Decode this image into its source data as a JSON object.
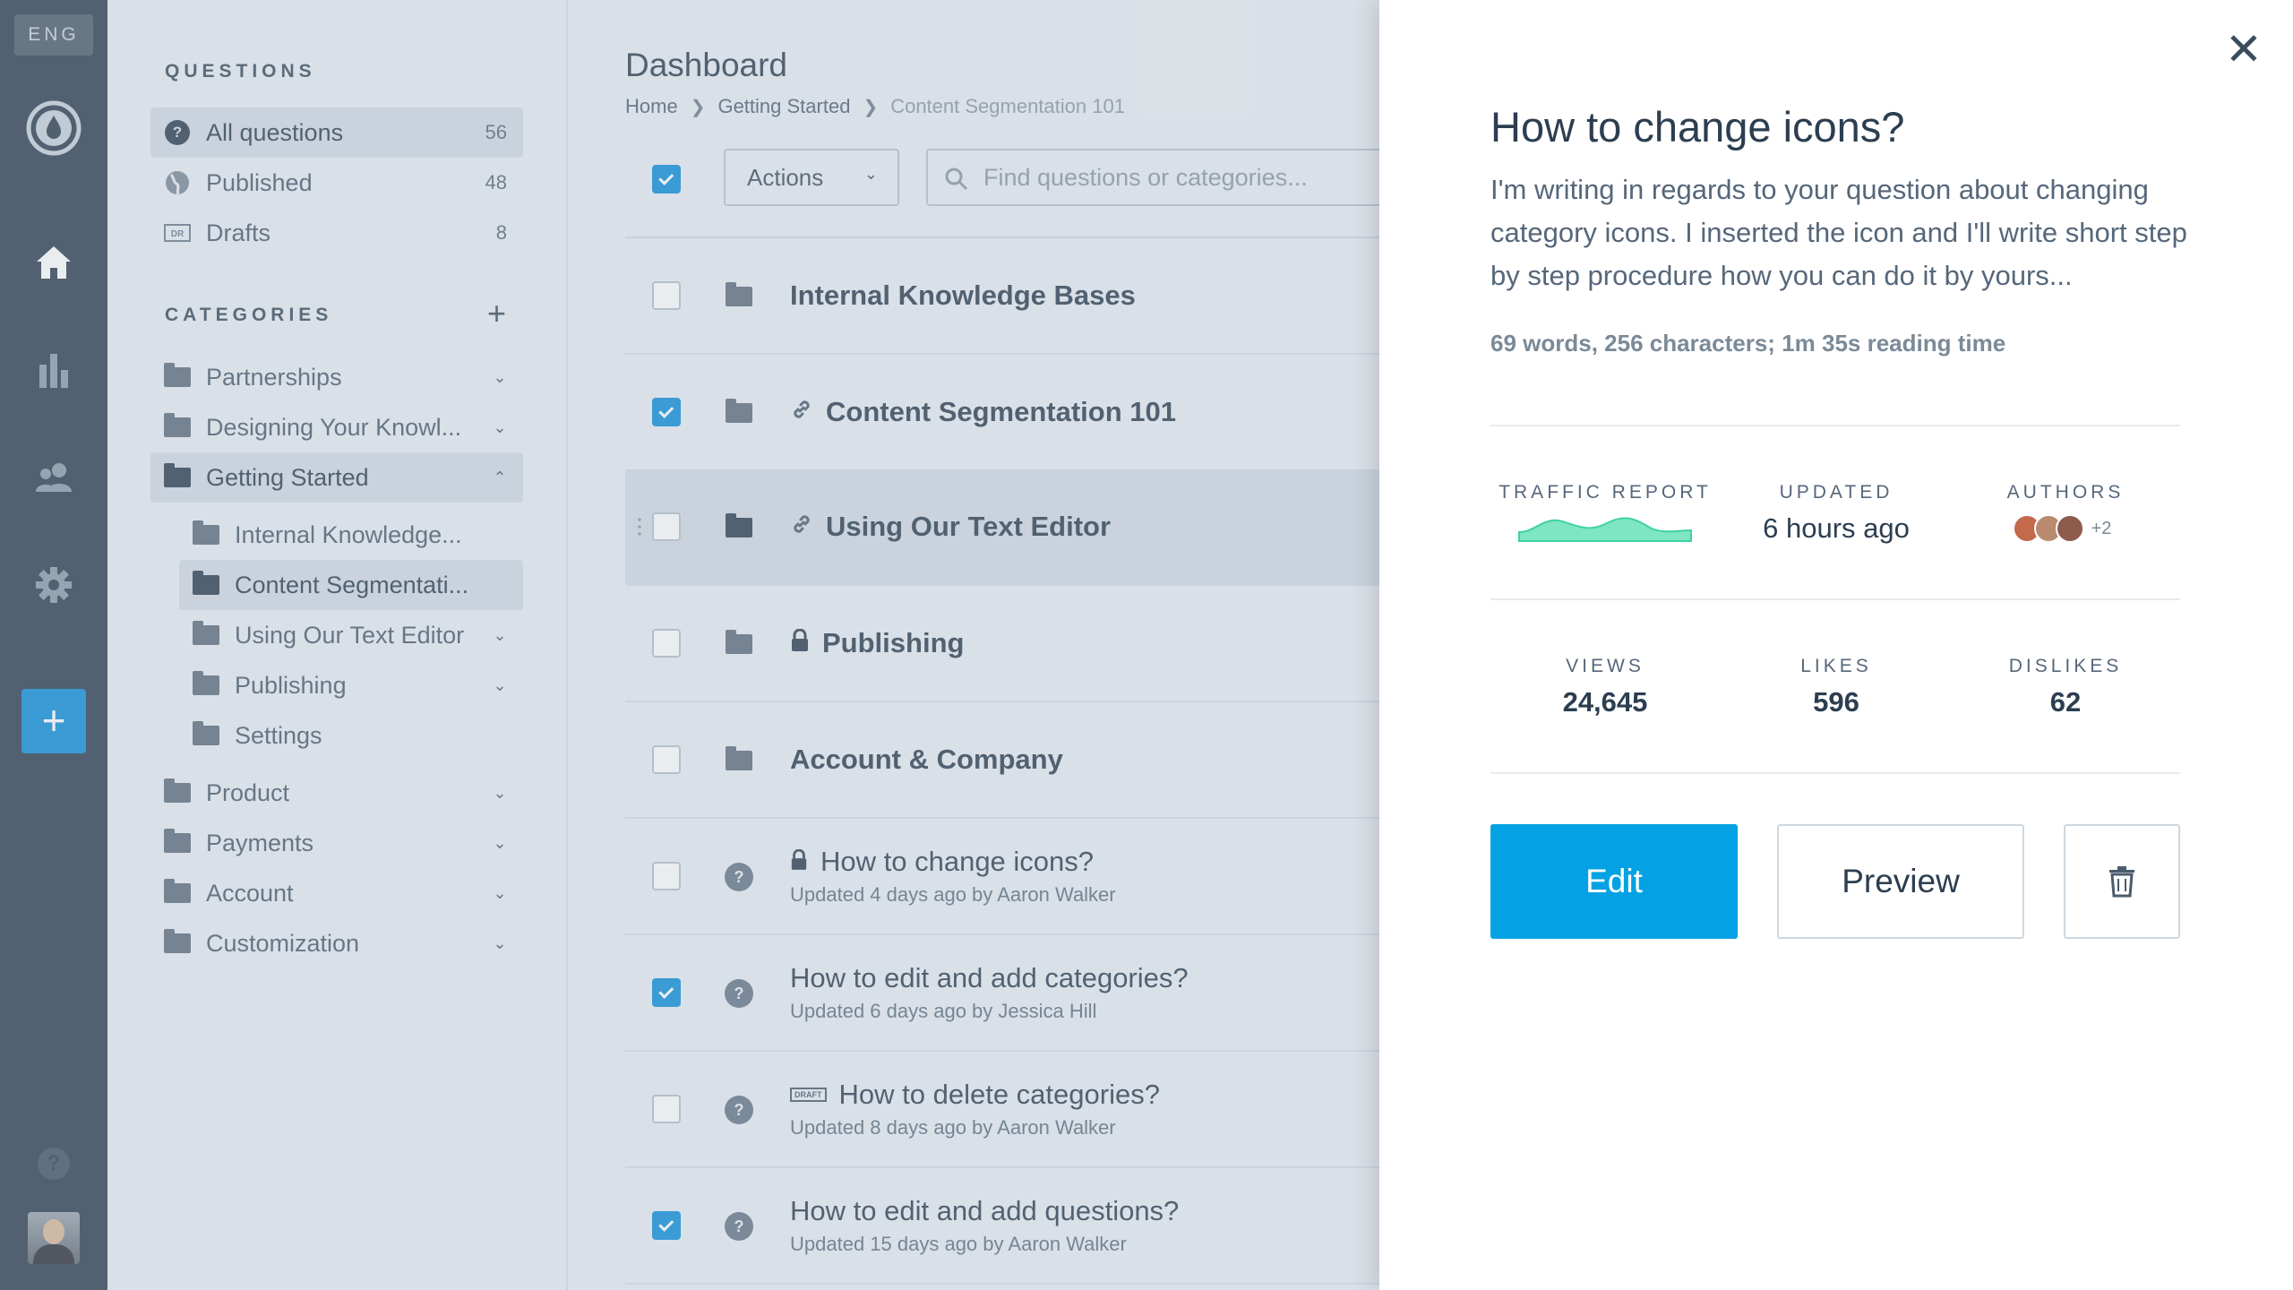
{
  "rail": {
    "lang": "ENG",
    "items": [
      {
        "icon": "logo-drop-icon"
      },
      {
        "icon": "home-icon"
      },
      {
        "icon": "bar-chart-icon"
      },
      {
        "icon": "users-icon"
      },
      {
        "icon": "gear-icon"
      }
    ],
    "add_label": "+",
    "help_label": "?"
  },
  "sidebar": {
    "questions_heading": "QUESTIONS",
    "question_filters": [
      {
        "label": "All questions",
        "count": "56"
      },
      {
        "label": "Published",
        "count": "48"
      },
      {
        "label": "Drafts",
        "count": "8"
      }
    ],
    "categories_heading": "CATEGORIES",
    "categories": [
      {
        "label": "Partnerships"
      },
      {
        "label": "Designing Your Knowl..."
      },
      {
        "label": "Getting Started"
      },
      {
        "label": "Internal Knowledge..."
      },
      {
        "label": "Content Segmentati..."
      },
      {
        "label": "Using Our Text Editor"
      },
      {
        "label": "Publishing"
      },
      {
        "label": "Settings"
      },
      {
        "label": "Product"
      },
      {
        "label": "Payments"
      },
      {
        "label": "Account"
      },
      {
        "label": "Customization"
      }
    ]
  },
  "main": {
    "title": "Dashboard",
    "breadcrumb": [
      "Home",
      "Getting Started",
      "Content Segmentation 101"
    ],
    "actions_label": "Actions",
    "search_placeholder": "Find questions or categories...",
    "rows": [
      {
        "title": "Internal Knowledge Bases"
      },
      {
        "title": "Content Segmentation 101"
      },
      {
        "title": "Using Our Text Editor"
      },
      {
        "title": "Publishing"
      },
      {
        "title": "Account & Company"
      },
      {
        "title": "How to change icons?",
        "sub": "Updated 4 days ago by Aaron Walker"
      },
      {
        "title": "How to edit and add categories?",
        "sub": "Updated 6 days ago by Jessica Hill"
      },
      {
        "title": "How to delete categories?",
        "sub": "Updated 8 days ago by Aaron Walker"
      },
      {
        "title": "How to edit and add questions?",
        "sub": "Updated 15 days ago by Aaron Walker"
      }
    ]
  },
  "panel": {
    "title": "How to change icons?",
    "body": "I'm writing in regards to your question about changing category icons. I inserted the icon and I'll write short step by step procedure how you can do it by yours...",
    "meta": "69 words, 256 characters; 1m 35s reading time",
    "traffic_label": "TRAFFIC REPORT",
    "updated_label": "UPDATED",
    "updated_value": "6 hours ago",
    "authors_label": "AUTHORS",
    "authors_more": "+2",
    "views_label": "VIEWS",
    "views_value": "24,645",
    "likes_label": "LIKES",
    "likes_value": "596",
    "dislikes_label": "DISLIKES",
    "dislikes_value": "62",
    "edit_label": "Edit",
    "preview_label": "Preview"
  },
  "colors": {
    "rail_bg": "#2c3e50",
    "accent": "#04a2e4",
    "sparkline": "#3fd3a0"
  }
}
